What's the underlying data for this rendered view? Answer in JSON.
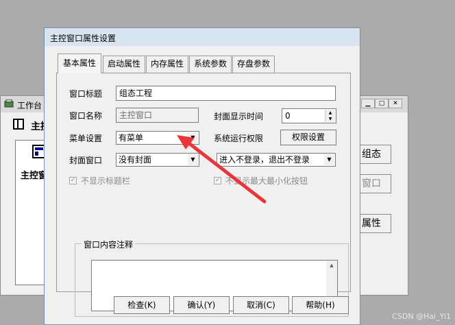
{
  "background_window": {
    "title": "工作台",
    "tab_fragment": "主控",
    "list_item_label": "主控窗",
    "side_buttons": [
      "组态",
      "窗口",
      "属性"
    ],
    "window_buttons": [
      "minimize-icon",
      "maximize-icon",
      "close-icon"
    ]
  },
  "dialog": {
    "title": "主控窗口属性设置",
    "tabs": [
      "基本属性",
      "启动属性",
      "内存属性",
      "系统参数",
      "存盘参数"
    ],
    "active_tab": "基本属性",
    "fields": {
      "window_title_label": "窗口标题",
      "window_title_value": "组态工程",
      "window_name_label": "窗口名称",
      "window_name_value": "主控窗口",
      "cover_time_label": "封面显示时间",
      "cover_time_value": "0",
      "menu_label": "菜单设置",
      "menu_value": "有菜单",
      "run_permission_label": "系统运行权限",
      "permission_button": "权限设置",
      "cover_window_label": "封面窗口",
      "cover_window_value": "没有封面",
      "login_mode_value": "进入不登录，退出不登录",
      "hide_titlebar_label": "不显示标题栏",
      "hide_minmax_label": "不显示最大最小化按钮",
      "comment_group_label": "窗口内容注释",
      "comment_value": ""
    },
    "buttons": {
      "check": "检查(K)",
      "confirm": "确认(Y)",
      "cancel": "取消(C)",
      "help": "帮助(H)"
    }
  },
  "annotation": {
    "arrow_color": "#e8363a"
  },
  "watermark": "CSDN @Hai_Yi1"
}
